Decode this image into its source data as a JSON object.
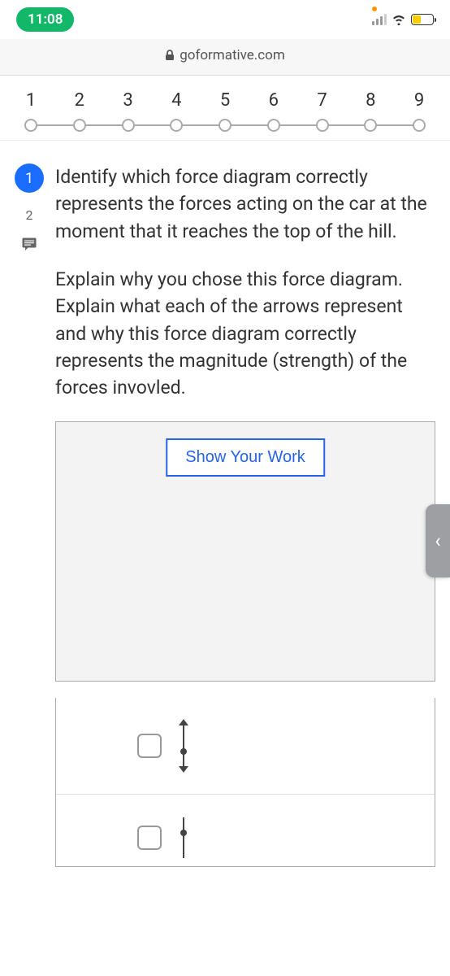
{
  "status": {
    "time": "11:08"
  },
  "browser": {
    "url": "goformative.com"
  },
  "nav": {
    "steps": [
      "1",
      "2",
      "3",
      "4",
      "5",
      "6",
      "7",
      "8",
      "9"
    ]
  },
  "sidebar": {
    "question_badge": "1",
    "points": "2"
  },
  "question": {
    "prompt": "Identify which force diagram correctly represents the forces acting on the car at the moment that it reaches the top of the hill.",
    "explain": "Explain why you chose this force diagram.  Explain what each of the arrows represent and why this force diagram correctly represents the magnitude (strength) of the forces invovled."
  },
  "buttons": {
    "show_work": "Show Your Work"
  }
}
